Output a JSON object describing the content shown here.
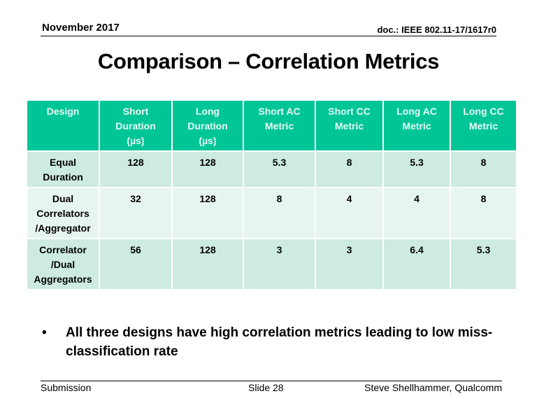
{
  "header": {
    "date": "November 2017",
    "doc_id": "doc.: IEEE 802.11-17/1617r0"
  },
  "title": "Comparison – Correlation Metrics",
  "table": {
    "columns": [
      "Design",
      "Short Duration (µs)",
      "Long Duration (µs)",
      "Short AC Metric",
      "Short CC Metric",
      "Long AC Metric",
      "Long CC Metric"
    ],
    "column_lines": [
      [
        "Design"
      ],
      [
        "Short",
        "Duration",
        "(µs)"
      ],
      [
        "Long",
        "Duration",
        "(µs)"
      ],
      [
        "Short AC",
        "Metric"
      ],
      [
        "Short CC",
        "Metric"
      ],
      [
        "Long AC",
        "Metric"
      ],
      [
        "Long CC",
        "Metric"
      ]
    ],
    "rows": [
      {
        "design_lines": [
          "Equal",
          "Duration"
        ],
        "design": "Equal Duration",
        "short_duration": "128",
        "long_duration": "128",
        "short_ac": "5.3",
        "short_cc": "8",
        "long_ac": "5.3",
        "long_cc": "8"
      },
      {
        "design_lines": [
          "Dual",
          "Correlators",
          "/Aggregator"
        ],
        "design": "Dual Correlators /Aggregator",
        "short_duration": "32",
        "long_duration": "128",
        "short_ac": "8",
        "short_cc": "4",
        "long_ac": "4",
        "long_cc": "8"
      },
      {
        "design_lines": [
          "Correlator",
          "/Dual",
          "Aggregators"
        ],
        "design": "Correlator /Dual Aggregators",
        "short_duration": "56",
        "long_duration": "128",
        "short_ac": "3",
        "short_cc": "3",
        "long_ac": "6.4",
        "long_cc": "5.3"
      }
    ]
  },
  "bullets": [
    {
      "icon": "bullet-dot",
      "symbol": "•",
      "text": "All three designs have high correlation metrics leading to low miss-classification rate"
    }
  ],
  "footer": {
    "left": "Submission",
    "center": "Slide 28",
    "right": "Steve Shellhammer, Qualcomm"
  },
  "colors": {
    "header_fill": "#00c597",
    "row_dark": "#cdebe0",
    "row_light": "#e7f5ef"
  }
}
